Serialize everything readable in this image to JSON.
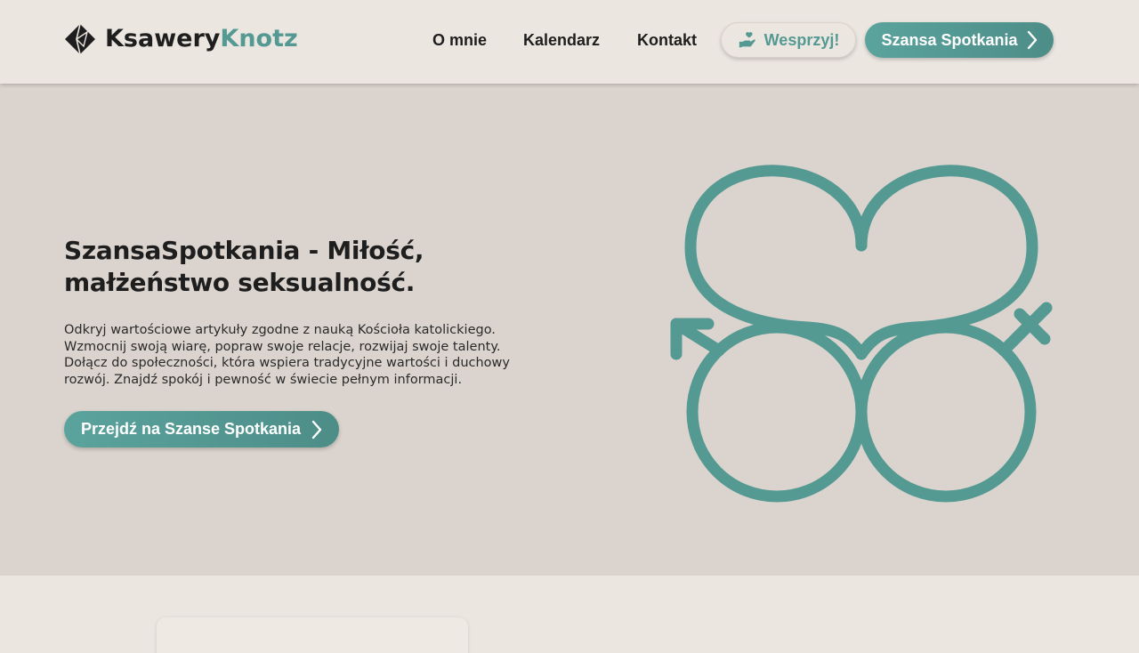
{
  "header": {
    "logo": {
      "first": "Ksawery",
      "second": "Knotz"
    },
    "nav": [
      {
        "label": "O mnie"
      },
      {
        "label": "Kalendarz"
      },
      {
        "label": "Kontakt"
      }
    ],
    "support_button": {
      "label": "Wesprzyj!",
      "icon": "heart-hand-icon"
    },
    "cta_button": {
      "label": "Szansa Spotkania",
      "icon": "chevron-right-icon"
    }
  },
  "hero": {
    "title": "SzansaSpotkania - Miłość, małżeństwo seksualność.",
    "description": "Odkryj wartościowe artykuły zgodne z nauką Kościoła katolickiego. Wzmocnij swoją wiarę, popraw swoje relacje, rozwijaj swoje talenty. Dołącz do społeczności, która wspiera tradycyjne wartości i duchowy rozwój. Znajdź spokój i pewność w świecie pełnym informacji.",
    "button": {
      "label": "Przejdź na Szanse Spotkania",
      "icon": "chevron-right-icon"
    },
    "illustration": "heart-gender-symbols-icon"
  },
  "colors": {
    "accent": "#559993",
    "background": "#ece6e1",
    "hero_background": "#dbd4ce",
    "text": "#1e1e1e"
  }
}
